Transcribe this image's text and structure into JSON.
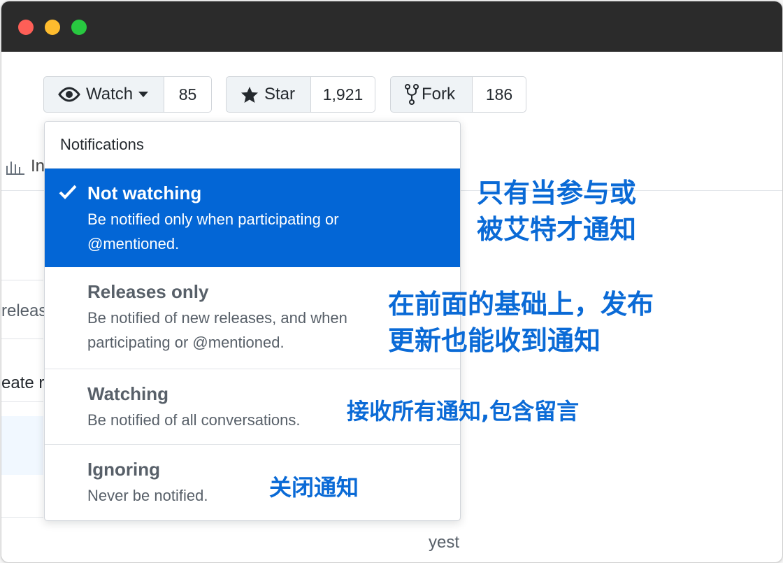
{
  "repo_buttons": {
    "watch": {
      "label": "Watch",
      "count": "85",
      "icon": "eye-icon"
    },
    "star": {
      "label": "Star",
      "count": "1,921",
      "icon": "star-icon"
    },
    "fork": {
      "label": "Fork",
      "count": "186",
      "icon": "fork-icon"
    }
  },
  "background_fragments": {
    "insights": "In",
    "releases": "releas",
    "create": "eate r",
    "yesterday": "yest"
  },
  "dropdown": {
    "header": "Notifications",
    "items": [
      {
        "title": "Not watching",
        "desc": "Be notified only when participating or @mentioned.",
        "selected": true
      },
      {
        "title": "Releases only",
        "desc": "Be notified of new releases, and when participating or @mentioned.",
        "selected": false
      },
      {
        "title": "Watching",
        "desc": "Be notified of all conversations.",
        "selected": false
      },
      {
        "title": "Ignoring",
        "desc": "Never be notified.",
        "selected": false
      }
    ]
  },
  "annotations": {
    "not_watching_line1": "只有当参与或",
    "not_watching_line2": "被艾特才通知",
    "releases_line1": "在前面的基础上，发布",
    "releases_line2": "更新也能收到通知",
    "watching": "接收所有通知,包含留言",
    "ignoring": "关闭通知"
  },
  "colors": {
    "selected_bg": "#0366d6",
    "annotation": "#0a6ad6"
  }
}
